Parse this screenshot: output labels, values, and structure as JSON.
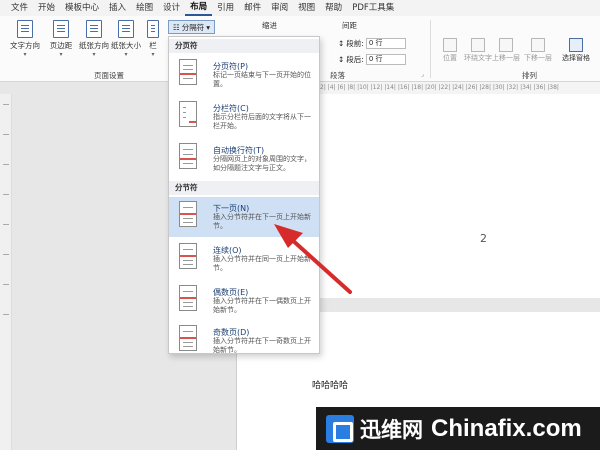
{
  "menu": [
    "文件",
    "开始",
    "模板中心",
    "插入",
    "绘图",
    "设计",
    "布局",
    "引用",
    "邮件",
    "审阅",
    "视图",
    "帮助",
    "PDF工具集"
  ],
  "ribbon": {
    "buttons": [
      "文字方向",
      "页边距",
      "纸张方向",
      "纸张大小",
      "栏"
    ],
    "breaks_label": "分隔符",
    "indent_label": "缩进",
    "spacing_label": "间距",
    "before_label": "段前:",
    "after_label": "段后:",
    "before_value": "0 行",
    "after_value": "0 行",
    "page_setup_group": "页面设置",
    "paragraph_group": "段落",
    "arrange_group": "排列",
    "arrange_buttons": [
      "位置",
      "环绕文字",
      "上移一层",
      "下移一层",
      "选择窗格"
    ]
  },
  "ruler_marks": "|2| |4| |6| |8| |10| |12| |14| |16| |18| |20| |22| |24| |26| |28| |30| |32| |34| |36| |38|",
  "dropdown": {
    "page_breaks_header": "分页符",
    "section_breaks_header": "分节符",
    "items": [
      {
        "title": "分页符(P)",
        "desc": "标记一页结束与下一页开始的位置。"
      },
      {
        "title": "分栏符(C)",
        "desc": "指示分栏符后面的文字将从下一栏开始。"
      },
      {
        "title": "自动换行符(T)",
        "desc": "分隔网页上的对象周围的文字，如分隔题注文字与正文。"
      },
      {
        "title": "下一页(N)",
        "desc": "插入分节符并在下一页上开始新节。"
      },
      {
        "title": "连续(O)",
        "desc": "插入分节符并在同一页上开始新节。"
      },
      {
        "title": "偶数页(E)",
        "desc": "插入分节符并在下一偶数页上开始新节。"
      },
      {
        "title": "奇数页(D)",
        "desc": "插入分节符并在下一奇数页上开始新节。"
      }
    ]
  },
  "document": {
    "page_number": "2",
    "text": "哈哈哈哈"
  },
  "watermark": {
    "cn": "迅维网",
    "en": "Chinafix.com"
  },
  "colors": {
    "accent": "#2b579a",
    "highlight": "#cfe0f5",
    "arrow": "#d72b2b"
  }
}
